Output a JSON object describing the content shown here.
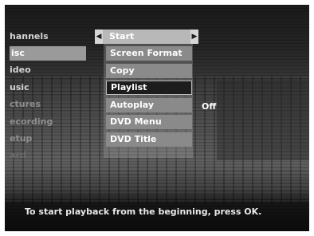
{
  "left_menu": [
    {
      "label": "hannels",
      "state": "normal"
    },
    {
      "label": "isc",
      "state": "active"
    },
    {
      "label": "ideo",
      "state": "normal"
    },
    {
      "label": "usic",
      "state": "normal"
    },
    {
      "label": "ctures",
      "state": "dim"
    },
    {
      "label": "ecording",
      "state": "dim"
    },
    {
      "label": "etup",
      "state": "dim"
    },
    {
      "label": "ard",
      "state": "dimmer"
    }
  ],
  "submenu": {
    "header": "Start",
    "items": [
      "Screen Format",
      "Copy",
      "Playlist",
      "Autoplay",
      "DVD Menu",
      "DVD Title"
    ],
    "selected_index": 2,
    "autoplay_value": "Off"
  },
  "help_text": "To start playback from the beginning, press OK.",
  "icons": {
    "left_arrow": "caret-left-icon",
    "right_arrow": "caret-right-icon"
  },
  "colors": {
    "highlight": "#9a9a9a",
    "selected_bg": "#1d1d1d",
    "menu_item_bg": "#8a8a8a"
  }
}
